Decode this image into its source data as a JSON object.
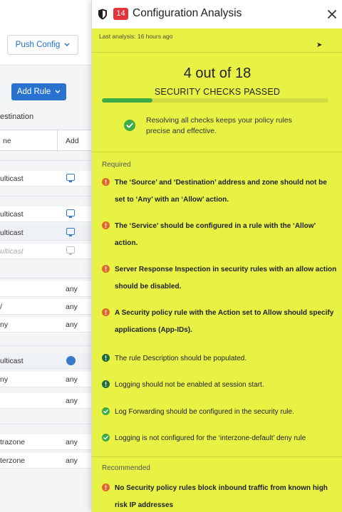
{
  "background_app": {
    "push_config_label": "Push Config",
    "add_rule_label": "Add Rule",
    "destination_header": "estination",
    "column_zone": "ne",
    "column_address": "Add",
    "rows": [
      {
        "zone": "ulticast",
        "address": ""
      },
      {
        "zone": "ulticast",
        "address": ""
      },
      {
        "zone": "ulticast",
        "address": ""
      },
      {
        "zone": "ulticast",
        "address": ""
      },
      {
        "zone": "",
        "address": "any"
      },
      {
        "zone": "/",
        "address": "any"
      },
      {
        "zone": "ny",
        "address": "any"
      },
      {
        "zone": "ulticast",
        "address": ""
      },
      {
        "zone": "ny",
        "address": "any"
      },
      {
        "zone": "",
        "address": "any"
      },
      {
        "zone": "trazone",
        "address": "any"
      },
      {
        "zone": "terzone",
        "address": "any"
      }
    ]
  },
  "panel": {
    "title": "Configuration Analysis",
    "badge_count": "14",
    "last_analysis": "Last analysis: 16 hours ago",
    "score": {
      "passed": "4",
      "middle": "out of",
      "total": "18",
      "label": "SECURITY CHECKS PASSED",
      "progress_fraction": 0.2222
    },
    "tip": "Resolving all checks keeps your policy rules precise and effective.",
    "sections": {
      "required_label": "Required",
      "recommended_label": "Recommended"
    },
    "required_items": [
      {
        "status": "error",
        "text": "The ‘Source’ and ‘Destination’ address and zone should not be set to ‘Any’ with an ‘Allow’ action."
      },
      {
        "status": "error",
        "text": "The ‘Service’ should be configured in a rule with the ‘Allow’ action."
      },
      {
        "status": "error",
        "text": "Server Response Inspection in security rules with an allow action should be disabled."
      },
      {
        "status": "error",
        "text": "A Security policy rule with the Action set to Allow should specify applications (App-IDs)."
      },
      {
        "status": "info",
        "text": "The rule Description should be populated."
      },
      {
        "status": "info",
        "text": "Logging should not be enabled at session start."
      },
      {
        "status": "pass",
        "text": "Log Forwarding should be configured in the security rule."
      },
      {
        "status": "pass",
        "text": "Logging is not configured for the ‘interzone-default’ deny rule"
      }
    ],
    "recommended_items": [
      {
        "status": "error",
        "text": "No Security policy rules block inbound traffic from known high risk IP addresses"
      }
    ]
  },
  "colors": {
    "panel_background": "#e8f245",
    "error": "#e0662c",
    "info": "#1f6b3a",
    "pass": "#3dab48",
    "badge": "#e2353b",
    "accent_blue": "#2a72d0"
  },
  "icons": {
    "header_left": "shield-icon",
    "close": "close-icon",
    "tip": "check-circle-icon",
    "error": "exclamation-circle-icon",
    "info": "exclamation-circle-icon",
    "pass": "check-circle-icon"
  }
}
